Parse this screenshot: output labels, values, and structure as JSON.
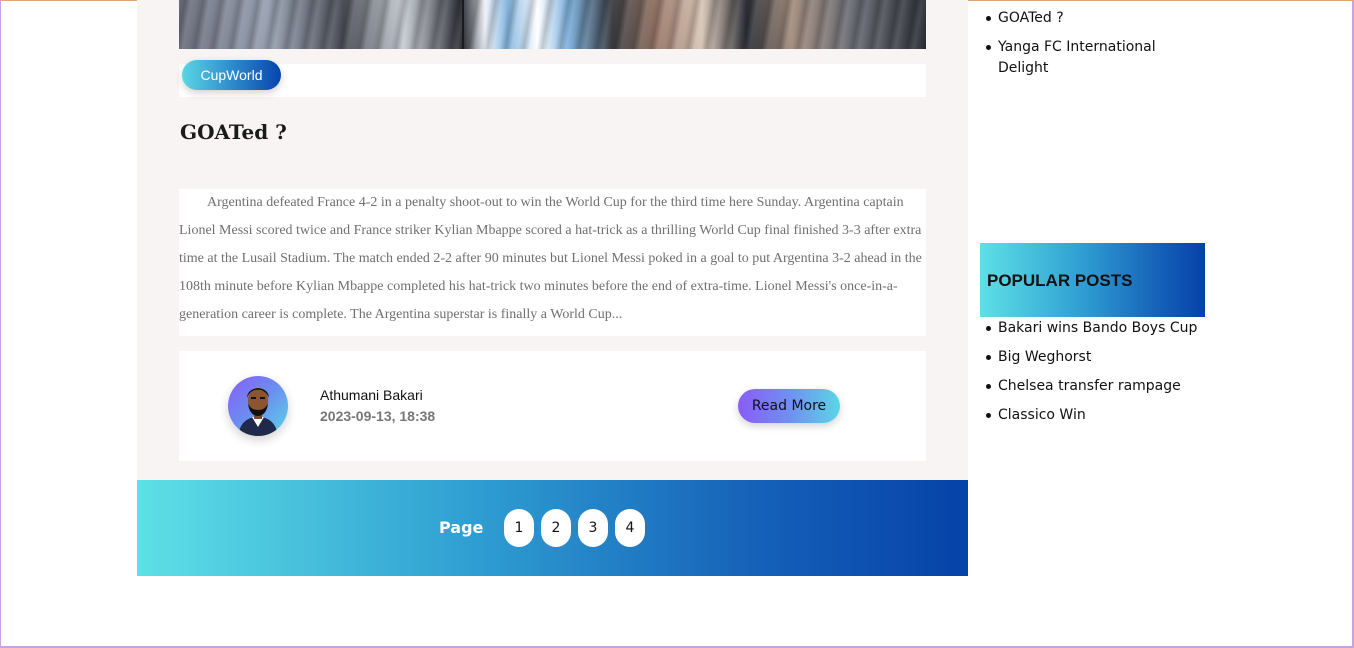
{
  "post": {
    "category": "CupWorld",
    "title": "GOATed ?",
    "excerpt": "Argentina defeated France 4-2 in a penalty shoot-out to win the World Cup for the third time here Sunday.  Argentina captain Lionel Messi scored twice and France striker Kylian Mbappe scored a hat-trick as a thrilling World Cup final finished 3-3 after extra time at the Lusail Stadium.  The match ended 2-2 after 90 minutes but Lionel Messi poked in a goal to put Argentina 3-2 ahead in the 108th minute before Kylian Mbappe completed his hat-trick two minutes before the end of extra-time.  Lionel Messi's once-in-a-generation career is complete. The Argentina superstar is finally a World Cup...",
    "author": "Athumani Bakari",
    "date": "2023-09-13, 18:38",
    "read_more_label": "Read More"
  },
  "pagination": {
    "label": "Page",
    "pages": [
      "1",
      "2",
      "3",
      "4"
    ]
  },
  "sidebar": {
    "recent_posts": [
      "GOATed ?",
      "Yanga FC International Delight"
    ],
    "popular_title": "POPULAR POSTS",
    "popular_posts": [
      "Bakari wins Bando Boys Cup",
      "Big Weghorst",
      "Chelsea transfer rampage",
      "Classico Win"
    ]
  },
  "colors": {
    "accent_cyan": "#5ee0e6",
    "accent_blue": "#0642a8",
    "accent_purple": "#8a5cf6",
    "main_bg": "#f8f4f3"
  },
  "icons": {
    "avatar": "author-avatar-icon"
  }
}
